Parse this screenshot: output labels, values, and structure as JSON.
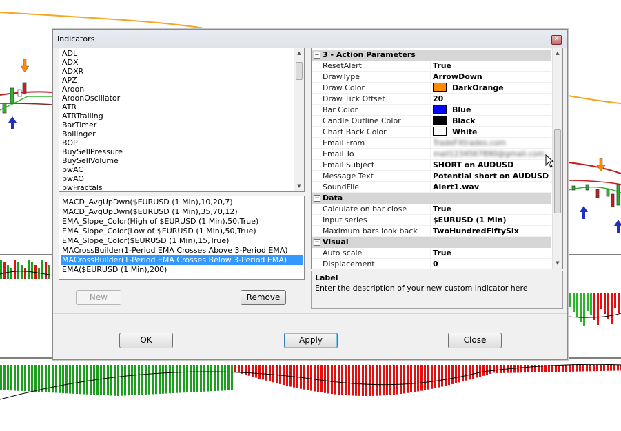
{
  "dialog": {
    "title": "Indicators",
    "close_glyph": "✕"
  },
  "indicator_list": [
    "ADL",
    "ADX",
    "ADXR",
    "APZ",
    "Aroon",
    "AroonOscillator",
    "ATR",
    "ATRTrailing",
    "BarTimer",
    "Bollinger",
    "BOP",
    "BuySellPressure",
    "BuySellVolume",
    "bwAC",
    "bwAO",
    "bwFractals"
  ],
  "added_indicators": [
    "MACD_AvgUpDwn($EURUSD (1 Min),10,20,7)",
    "MACD_AvgUpDwn($EURUSD (1 Min),35,70,12)",
    "EMA_Slope_Color(High of $EURUSD (1 Min),50,True)",
    "EMA_Slope_Color(Low of $EURUSD (1 Min),50,True)",
    "EMA_Slope_Color($EURUSD (1 Min),15,True)",
    "MACrossBuilder(1-Period EMA Crosses Above  3-Period EMA)",
    "MACrossBuilder(1-Period EMA  Crosses Below 3-Period EMA)",
    "EMA($EURUSD (1 Min),200)"
  ],
  "selected_added_index": 6,
  "buttons": {
    "new": "New",
    "remove": "Remove",
    "ok": "OK",
    "apply": "Apply",
    "close": "Close"
  },
  "property_grid": [
    {
      "type": "category",
      "label": "3 - Action Parameters",
      "sign": "⊟"
    },
    {
      "type": "prop",
      "name": "ResetAlert",
      "value": "True"
    },
    {
      "type": "prop",
      "name": "DrawType",
      "value": "ArrowDown"
    },
    {
      "type": "prop",
      "name": "Draw Color",
      "value": "DarkOrange",
      "swatch": "#ff8c00"
    },
    {
      "type": "prop",
      "name": "Draw Tick Offset",
      "value": "20"
    },
    {
      "type": "prop",
      "name": "Bar Color",
      "value": "Blue",
      "swatch": "#0000ff"
    },
    {
      "type": "prop",
      "name": "Candle Outline Color",
      "value": "Black",
      "swatch": "#000000"
    },
    {
      "type": "prop",
      "name": "Chart Back Color",
      "value": "White",
      "swatch": "#ffffff"
    },
    {
      "type": "prop",
      "name": "Email From",
      "value": "TradeFXtrades.com",
      "blurred": true
    },
    {
      "type": "prop",
      "name": "Email To",
      "value": "mail1234567890@gmail.com",
      "blurred": true
    },
    {
      "type": "prop",
      "name": "Email Subject",
      "value": "SHORT on AUDUSD"
    },
    {
      "type": "prop",
      "name": "Message Text",
      "value": "Potential short on AUDUSD"
    },
    {
      "type": "prop",
      "name": "SoundFile",
      "value": "Alert1.wav"
    },
    {
      "type": "category",
      "label": "Data",
      "sign": "⊟"
    },
    {
      "type": "prop",
      "name": "Calculate on bar close",
      "value": "True"
    },
    {
      "type": "prop",
      "name": "Input series",
      "value": "$EURUSD (1 Min)"
    },
    {
      "type": "prop",
      "name": "Maximum bars look back",
      "value": "TwoHundredFiftySix"
    },
    {
      "type": "category",
      "label": "Visual",
      "sign": "⊟"
    },
    {
      "type": "prop",
      "name": "Auto scale",
      "value": "True"
    },
    {
      "type": "prop",
      "name": "Displacement",
      "value": "0"
    }
  ],
  "description": {
    "title": "Label",
    "text": "Enter the description of your new custom indicator here"
  },
  "colors": {
    "selection": "#3399ff",
    "bull_bar": "#1e9e1e",
    "bear_bar": "#e01010",
    "ma_orange": "#f5a623",
    "ma_red": "#c81e1e"
  }
}
